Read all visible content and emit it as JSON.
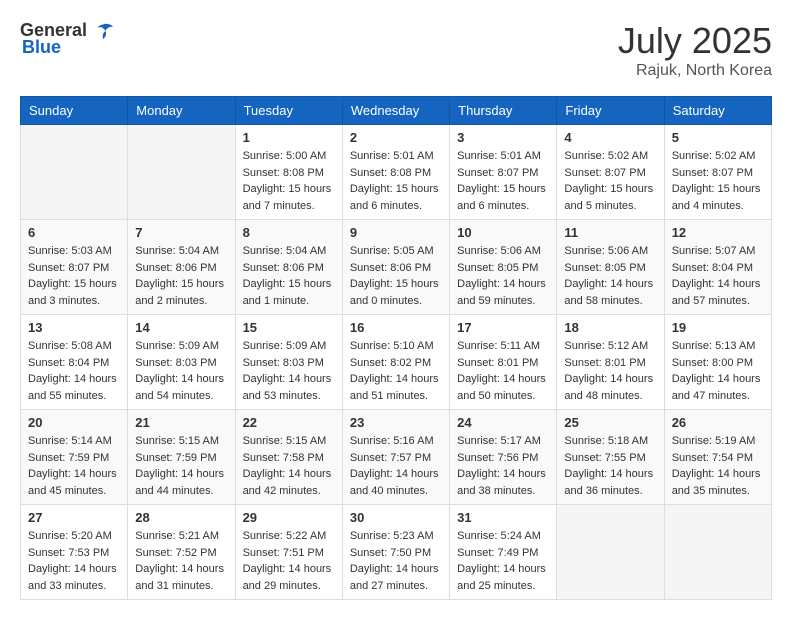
{
  "header": {
    "logo_general": "General",
    "logo_blue": "Blue",
    "title": "July 2025",
    "location": "Rajuk, North Korea"
  },
  "calendar": {
    "days_of_week": [
      "Sunday",
      "Monday",
      "Tuesday",
      "Wednesday",
      "Thursday",
      "Friday",
      "Saturday"
    ],
    "weeks": [
      [
        {
          "day": "",
          "info": ""
        },
        {
          "day": "",
          "info": ""
        },
        {
          "day": "1",
          "info": "Sunrise: 5:00 AM\nSunset: 8:08 PM\nDaylight: 15 hours\nand 7 minutes."
        },
        {
          "day": "2",
          "info": "Sunrise: 5:01 AM\nSunset: 8:08 PM\nDaylight: 15 hours\nand 6 minutes."
        },
        {
          "day": "3",
          "info": "Sunrise: 5:01 AM\nSunset: 8:07 PM\nDaylight: 15 hours\nand 6 minutes."
        },
        {
          "day": "4",
          "info": "Sunrise: 5:02 AM\nSunset: 8:07 PM\nDaylight: 15 hours\nand 5 minutes."
        },
        {
          "day": "5",
          "info": "Sunrise: 5:02 AM\nSunset: 8:07 PM\nDaylight: 15 hours\nand 4 minutes."
        }
      ],
      [
        {
          "day": "6",
          "info": "Sunrise: 5:03 AM\nSunset: 8:07 PM\nDaylight: 15 hours\nand 3 minutes."
        },
        {
          "day": "7",
          "info": "Sunrise: 5:04 AM\nSunset: 8:06 PM\nDaylight: 15 hours\nand 2 minutes."
        },
        {
          "day": "8",
          "info": "Sunrise: 5:04 AM\nSunset: 8:06 PM\nDaylight: 15 hours\nand 1 minute."
        },
        {
          "day": "9",
          "info": "Sunrise: 5:05 AM\nSunset: 8:06 PM\nDaylight: 15 hours\nand 0 minutes."
        },
        {
          "day": "10",
          "info": "Sunrise: 5:06 AM\nSunset: 8:05 PM\nDaylight: 14 hours\nand 59 minutes."
        },
        {
          "day": "11",
          "info": "Sunrise: 5:06 AM\nSunset: 8:05 PM\nDaylight: 14 hours\nand 58 minutes."
        },
        {
          "day": "12",
          "info": "Sunrise: 5:07 AM\nSunset: 8:04 PM\nDaylight: 14 hours\nand 57 minutes."
        }
      ],
      [
        {
          "day": "13",
          "info": "Sunrise: 5:08 AM\nSunset: 8:04 PM\nDaylight: 14 hours\nand 55 minutes."
        },
        {
          "day": "14",
          "info": "Sunrise: 5:09 AM\nSunset: 8:03 PM\nDaylight: 14 hours\nand 54 minutes."
        },
        {
          "day": "15",
          "info": "Sunrise: 5:09 AM\nSunset: 8:03 PM\nDaylight: 14 hours\nand 53 minutes."
        },
        {
          "day": "16",
          "info": "Sunrise: 5:10 AM\nSunset: 8:02 PM\nDaylight: 14 hours\nand 51 minutes."
        },
        {
          "day": "17",
          "info": "Sunrise: 5:11 AM\nSunset: 8:01 PM\nDaylight: 14 hours\nand 50 minutes."
        },
        {
          "day": "18",
          "info": "Sunrise: 5:12 AM\nSunset: 8:01 PM\nDaylight: 14 hours\nand 48 minutes."
        },
        {
          "day": "19",
          "info": "Sunrise: 5:13 AM\nSunset: 8:00 PM\nDaylight: 14 hours\nand 47 minutes."
        }
      ],
      [
        {
          "day": "20",
          "info": "Sunrise: 5:14 AM\nSunset: 7:59 PM\nDaylight: 14 hours\nand 45 minutes."
        },
        {
          "day": "21",
          "info": "Sunrise: 5:15 AM\nSunset: 7:59 PM\nDaylight: 14 hours\nand 44 minutes."
        },
        {
          "day": "22",
          "info": "Sunrise: 5:15 AM\nSunset: 7:58 PM\nDaylight: 14 hours\nand 42 minutes."
        },
        {
          "day": "23",
          "info": "Sunrise: 5:16 AM\nSunset: 7:57 PM\nDaylight: 14 hours\nand 40 minutes."
        },
        {
          "day": "24",
          "info": "Sunrise: 5:17 AM\nSunset: 7:56 PM\nDaylight: 14 hours\nand 38 minutes."
        },
        {
          "day": "25",
          "info": "Sunrise: 5:18 AM\nSunset: 7:55 PM\nDaylight: 14 hours\nand 36 minutes."
        },
        {
          "day": "26",
          "info": "Sunrise: 5:19 AM\nSunset: 7:54 PM\nDaylight: 14 hours\nand 35 minutes."
        }
      ],
      [
        {
          "day": "27",
          "info": "Sunrise: 5:20 AM\nSunset: 7:53 PM\nDaylight: 14 hours\nand 33 minutes."
        },
        {
          "day": "28",
          "info": "Sunrise: 5:21 AM\nSunset: 7:52 PM\nDaylight: 14 hours\nand 31 minutes."
        },
        {
          "day": "29",
          "info": "Sunrise: 5:22 AM\nSunset: 7:51 PM\nDaylight: 14 hours\nand 29 minutes."
        },
        {
          "day": "30",
          "info": "Sunrise: 5:23 AM\nSunset: 7:50 PM\nDaylight: 14 hours\nand 27 minutes."
        },
        {
          "day": "31",
          "info": "Sunrise: 5:24 AM\nSunset: 7:49 PM\nDaylight: 14 hours\nand 25 minutes."
        },
        {
          "day": "",
          "info": ""
        },
        {
          "day": "",
          "info": ""
        }
      ]
    ]
  }
}
